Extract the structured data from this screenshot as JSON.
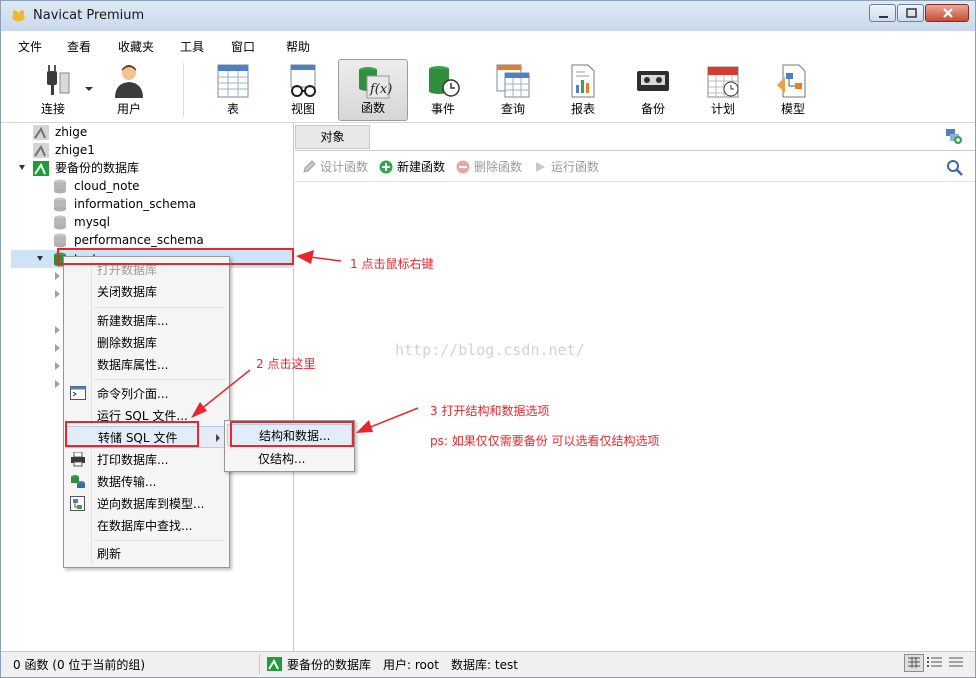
{
  "window": {
    "title": "Navicat Premium"
  },
  "menubar": {
    "items": [
      "文件",
      "查看",
      "收藏夹",
      "工具",
      "窗口",
      "帮助"
    ]
  },
  "toolbar": {
    "items": [
      {
        "label": "连接",
        "icon": "plug-icon"
      },
      {
        "label": "用户",
        "icon": "user-icon"
      },
      {
        "label": "表",
        "icon": "table-icon"
      },
      {
        "label": "视图",
        "icon": "view-icon"
      },
      {
        "label": "函数",
        "icon": "function-icon",
        "active": true
      },
      {
        "label": "事件",
        "icon": "event-icon"
      },
      {
        "label": "查询",
        "icon": "query-icon"
      },
      {
        "label": "报表",
        "icon": "report-icon"
      },
      {
        "label": "备份",
        "icon": "backup-icon"
      },
      {
        "label": "计划",
        "icon": "schedule-icon"
      },
      {
        "label": "模型",
        "icon": "model-icon"
      }
    ]
  },
  "tree": {
    "connections": [
      "zhige",
      "zhige1",
      "要备份的数据库"
    ],
    "databases": [
      "cloud_note",
      "information_schema",
      "mysql",
      "performance_schema"
    ],
    "selected_db": "test"
  },
  "context_menu": {
    "items": [
      "打开数据库",
      "关闭数据库",
      "新建数据库...",
      "删除数据库",
      "数据库属性...",
      "命令列介面...",
      "运行 SQL 文件...",
      "转储 SQL 文件",
      "打印数据库...",
      "数据传输...",
      "逆向数据库到模型...",
      "在数据库中查找...",
      "刷新"
    ],
    "submenu": [
      "结构和数据...",
      "仅结构..."
    ]
  },
  "right_pane": {
    "tab": "对象",
    "actions": [
      "设计函数",
      "新建函数",
      "删除函数",
      "运行函数"
    ]
  },
  "statusbar": {
    "count": "0 函数 (0 位于当前的组)",
    "connection": "要备份的数据库",
    "user": "用户: root",
    "database": "数据库: test"
  },
  "annotations": {
    "step1": "1 点击鼠标右键",
    "step2": "2 点击这里",
    "step3": "3 打开结构和数据选项",
    "ps": "ps: 如果仅仅需要备份  可以选看仅结构选项"
  },
  "watermark": "http://blog.csdn.net/",
  "colors": {
    "annotation_red": "#e8262b",
    "selection_blue": "#cfe3f7",
    "navicat_green": "#1f9d3a"
  }
}
